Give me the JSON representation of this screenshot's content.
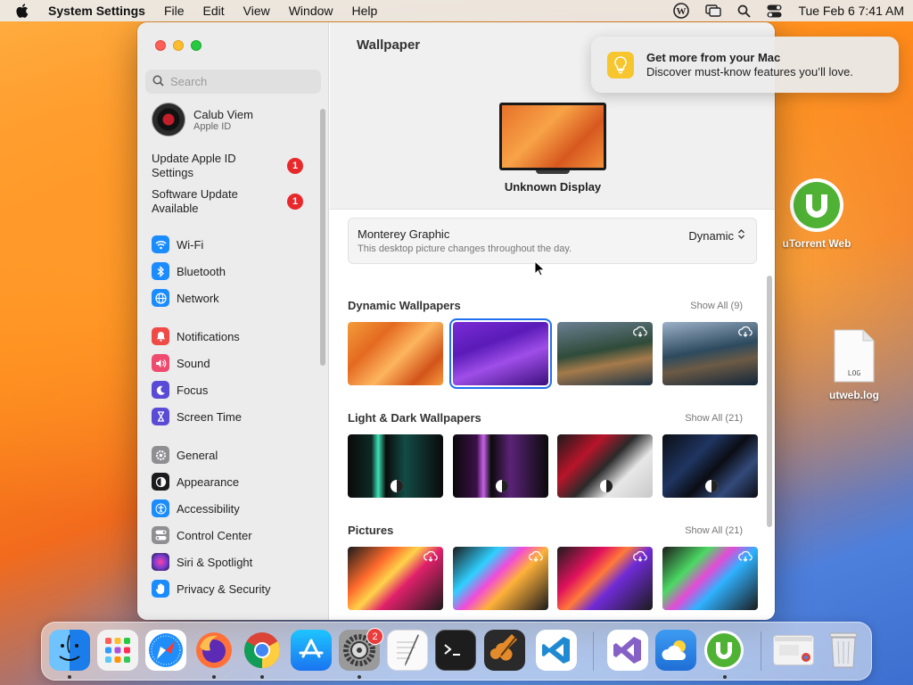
{
  "menubar": {
    "app_name": "System Settings",
    "items": [
      "File",
      "Edit",
      "View",
      "Window",
      "Help"
    ],
    "datetime": "Tue Feb 6  7:41 AM"
  },
  "sidebar": {
    "search_placeholder": "Search",
    "profile": {
      "name": "Calub Viem",
      "subtitle": "Apple ID"
    },
    "alerts": [
      {
        "label": "Update Apple ID Settings",
        "badge": "1"
      },
      {
        "label": "Software Update Available",
        "badge": "1"
      }
    ],
    "groups": [
      [
        {
          "label": "Wi-Fi",
          "icon": "wifi-icon",
          "color": "#1a8cff"
        },
        {
          "label": "Bluetooth",
          "icon": "bluetooth-icon",
          "color": "#1a8cff"
        },
        {
          "label": "Network",
          "icon": "globe-icon",
          "color": "#1a8cff"
        }
      ],
      [
        {
          "label": "Notifications",
          "icon": "bell-icon",
          "color": "#f04a46"
        },
        {
          "label": "Sound",
          "icon": "speaker-icon",
          "color": "#f04a6e"
        },
        {
          "label": "Focus",
          "icon": "moon-icon",
          "color": "#5a4bd6"
        },
        {
          "label": "Screen Time",
          "icon": "hourglass-icon",
          "color": "#5a4bd6"
        }
      ],
      [
        {
          "label": "General",
          "icon": "gear-icon",
          "color": "#8e8e93"
        },
        {
          "label": "Appearance",
          "icon": "appearance-icon",
          "color": "#1c1c1e"
        },
        {
          "label": "Accessibility",
          "icon": "accessibility-icon",
          "color": "#1a8cff"
        },
        {
          "label": "Control Center",
          "icon": "control-center-icon",
          "color": "#8e8e93"
        },
        {
          "label": "Siri & Spotlight",
          "icon": "siri-icon",
          "color": "#7a3cd0"
        },
        {
          "label": "Privacy & Security",
          "icon": "hand-icon",
          "color": "#1a8cff"
        }
      ]
    ]
  },
  "main": {
    "title": "Wallpaper",
    "display_label": "Unknown Display",
    "current": {
      "name": "Monterey Graphic",
      "description": "This desktop picture changes throughout the day.",
      "mode": "Dynamic"
    },
    "sections": [
      {
        "title": "Dynamic Wallpapers",
        "show_all": "Show All (9)"
      },
      {
        "title": "Light & Dark Wallpapers",
        "show_all": "Show All (21)"
      },
      {
        "title": "Pictures",
        "show_all": "Show All (21)"
      }
    ]
  },
  "notification": {
    "title": "Get more from your Mac",
    "body": "Discover must-know features you’ll love."
  },
  "desktop": {
    "icons": [
      {
        "label": "uTorrent Web"
      },
      {
        "label": "utweb.log",
        "file_tag": "LOG"
      }
    ]
  },
  "dock": {
    "settings_badge": "2",
    "apps": [
      "Finder",
      "Launchpad",
      "Safari",
      "Firefox",
      "Chrome",
      "App Store",
      "System Settings",
      "TextEdit",
      "Terminal",
      "GarageBand",
      "Visual Studio Code",
      "Visual Studio",
      "Weather",
      "uTorrent Web",
      "Chrome Window",
      "Trash"
    ]
  },
  "colors": {
    "accent": "#1f6ff0",
    "badge": "#e8282b"
  }
}
